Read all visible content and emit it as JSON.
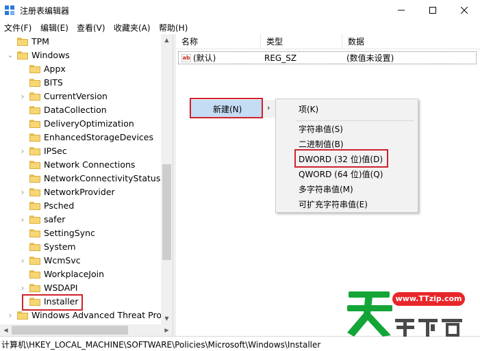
{
  "window": {
    "title": "注册表编辑器"
  },
  "menubar": {
    "items": [
      "文件(F)",
      "编辑(E)",
      "查看(V)",
      "收藏夹(A)",
      "帮助(H)"
    ]
  },
  "tree": {
    "items": [
      {
        "label": "TPM",
        "level": 1,
        "arrow": ""
      },
      {
        "label": "Windows",
        "level": 1,
        "arrow": "expanded"
      },
      {
        "label": "Appx",
        "level": 2,
        "arrow": ""
      },
      {
        "label": "BITS",
        "level": 2,
        "arrow": ""
      },
      {
        "label": "CurrentVersion",
        "level": 2,
        "arrow": "collapsed"
      },
      {
        "label": "DataCollection",
        "level": 2,
        "arrow": ""
      },
      {
        "label": "DeliveryOptimization",
        "level": 2,
        "arrow": ""
      },
      {
        "label": "EnhancedStorageDevices",
        "level": 2,
        "arrow": ""
      },
      {
        "label": "IPSec",
        "level": 2,
        "arrow": "collapsed"
      },
      {
        "label": "Network Connections",
        "level": 2,
        "arrow": ""
      },
      {
        "label": "NetworkConnectivityStatusInd",
        "level": 2,
        "arrow": ""
      },
      {
        "label": "NetworkProvider",
        "level": 2,
        "arrow": "collapsed"
      },
      {
        "label": "Psched",
        "level": 2,
        "arrow": ""
      },
      {
        "label": "safer",
        "level": 2,
        "arrow": "collapsed"
      },
      {
        "label": "SettingSync",
        "level": 2,
        "arrow": ""
      },
      {
        "label": "System",
        "level": 2,
        "arrow": ""
      },
      {
        "label": "WcmSvc",
        "level": 2,
        "arrow": "collapsed"
      },
      {
        "label": "WorkplaceJoin",
        "level": 2,
        "arrow": ""
      },
      {
        "label": "WSDAPI",
        "level": 2,
        "arrow": "collapsed"
      },
      {
        "label": "Installer",
        "level": 2,
        "arrow": ""
      },
      {
        "label": "Windows Advanced Threat Prote",
        "level": 1,
        "arrow": "collapsed"
      }
    ]
  },
  "list": {
    "columns": [
      "名称",
      "类型",
      "数据"
    ],
    "rows": [
      {
        "name": "(默认)",
        "type": "REG_SZ",
        "data": "(数值未设置)"
      }
    ]
  },
  "context_menu": {
    "new_label": "新建(N)",
    "arrow": "›",
    "submenu": [
      "项(K)",
      "字符串值(S)",
      "二进制值(B)",
      "DWORD (32 位)值(D)",
      "QWORD (64 位)值(Q)",
      "多字符串值(M)",
      "可扩充字符串值(E)"
    ]
  },
  "statusbar": {
    "path": "计算机\\HKEY_LOCAL_MACHINE\\SOFTWARE\\Policies\\Microsoft\\Windows\\Installer"
  },
  "watermark": {
    "url": "www.TTzip.com",
    "text": "天天下载"
  },
  "colors": {
    "highlight_red": "#d0212b",
    "menu_selected": "#c5dcf5",
    "folder_yellow": "#f6d675"
  }
}
